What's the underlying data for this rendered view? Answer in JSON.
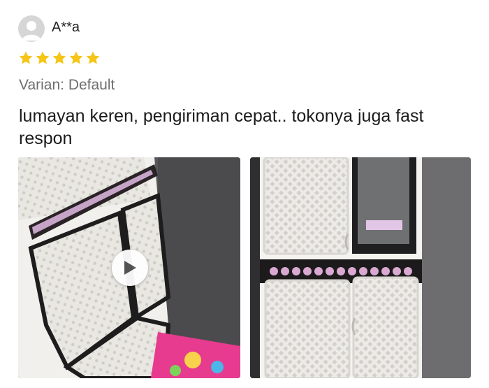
{
  "review": {
    "username": "A**a",
    "rating": 5,
    "rating_max": 5,
    "variant": "Varian: Default",
    "text": "lumayan keren, pengiriman cepat.. tokonya juga fast respon"
  },
  "colors": {
    "star": "#f5c518",
    "avatar_bg": "#d6d6d6",
    "variant_text": "#6e6e6e"
  },
  "media": [
    {
      "kind": "video",
      "icon": "play-icon"
    },
    {
      "kind": "photo"
    }
  ]
}
